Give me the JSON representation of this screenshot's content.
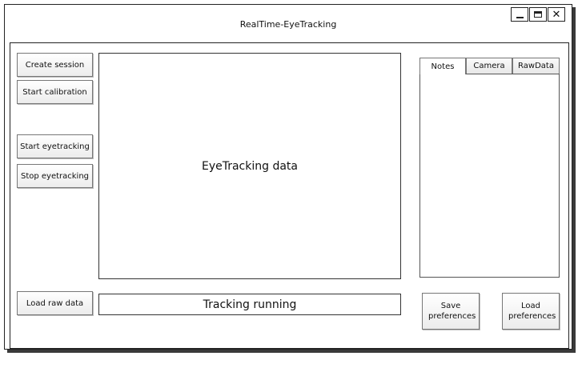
{
  "window": {
    "title": "RealTime-EyeTracking",
    "controls": {
      "minimize": "minimize-icon",
      "maximize": "maximize-icon",
      "close": "close-icon"
    }
  },
  "left_buttons": {
    "create_session": "Create session",
    "start_calibration": "Start calibration",
    "start_eyetracking": "Start eyetracking",
    "stop_eyetracking": "Stop eyetracking",
    "load_raw_data": "Load raw data"
  },
  "main": {
    "display_label": "EyeTracking data",
    "status_text": "Tracking running"
  },
  "tabs": [
    {
      "label": "Notes",
      "active": true
    },
    {
      "label": "Camera",
      "active": false
    },
    {
      "label": "RawData",
      "active": false
    }
  ],
  "right_buttons": {
    "save_preferences": "Save preferences",
    "load_preferences": "Load preferences"
  }
}
